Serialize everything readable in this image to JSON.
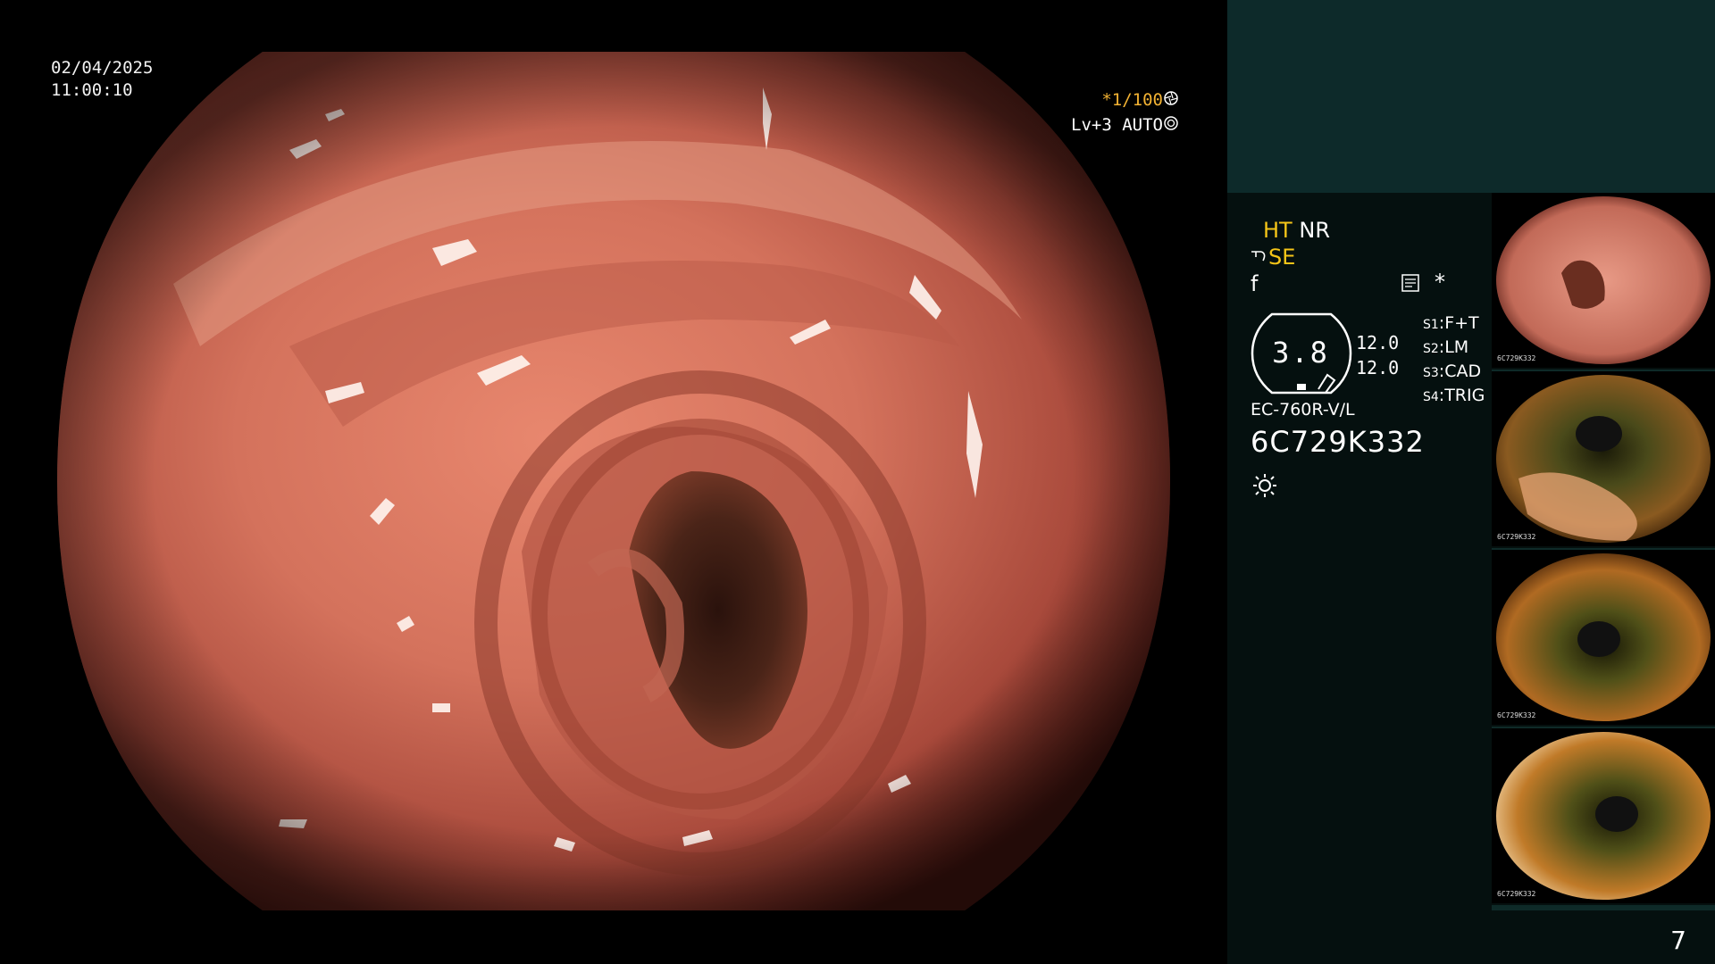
{
  "overlay": {
    "date": "02/04/2025",
    "time": "11:00:10",
    "shutter": "*1/100",
    "shutter_icon": "aperture-icon",
    "level": "Lv+3 AUTO",
    "level_icon": "iris-icon"
  },
  "status": {
    "ht": "HT",
    "nr": "NR",
    "se": "SE",
    "f_symbol": "f",
    "asterisk": "*",
    "gauge_value": "3.8",
    "values": [
      "12.0",
      "12.0"
    ],
    "switches": [
      {
        "key": "S1",
        "value": "F+T"
      },
      {
        "key": "S2",
        "value": "LM"
      },
      {
        "key": "S3",
        "value": "CAD"
      },
      {
        "key": "S4",
        "value": "TRIG"
      }
    ],
    "scope_model": "EC-760R-V/L",
    "scope_serial": "6C729K332"
  },
  "thumbnails": [
    {
      "label": "6C729K332",
      "style": "pink"
    },
    {
      "label": "6C729K332",
      "style": "green"
    },
    {
      "label": "6C729K332",
      "style": "green"
    },
    {
      "label": "6C729K332",
      "style": "green"
    }
  ],
  "page_number": "7",
  "colors": {
    "panel_top": "#0d2a2a",
    "panel_bg": "#05100f",
    "accent_yellow": "#f5c518",
    "accent_orange": "#f2b233"
  }
}
